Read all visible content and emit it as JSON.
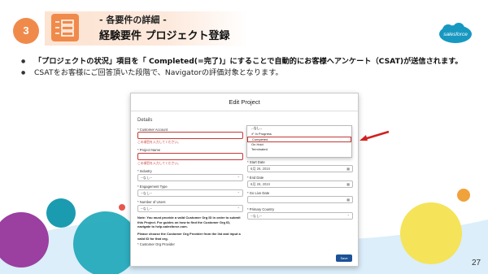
{
  "header": {
    "step_number": "3",
    "subtitle": "- 各要件の詳細 -",
    "title": "経験要件 プロジェクト登録",
    "logo_text": "salesforce"
  },
  "bullets": [
    {
      "text_pre": "「プロジェクトの状況」項目を「 Completed(=完了)」にすることで自動的にお客様へアンケート（CSAT)が送信されます。"
    },
    {
      "text": "CSATをお客様にご回答頂いた段階で、Navigatorの評価対象となります。"
    }
  ],
  "modal": {
    "title": "Edit Project",
    "section": "Details",
    "customer_account_label": "* Customer Account",
    "customer_account_error": "この項目を入力してください。",
    "project_name_label": "* Project Name",
    "project_name_error": "この項目を入力してください。",
    "industry_label": "* Industry",
    "industry_value": "--なし--",
    "engagement_type_label": "* Engagement Type",
    "engagement_type_value": "--なし--",
    "number_of_users_label": "* Number of Users",
    "number_of_users_value": "--なし--",
    "note": "Note: You must provide a valid Customer Org ID in order to submit this Project. For guides on how to find the Customer Org ID, navigate to help.salesforce.com.",
    "note2": "Please choose the Customer Org Provider from the list and input a valid ID for that org.",
    "customer_org_provider_label": "* Customer Org Provider",
    "start_date_label": "* Start Date",
    "start_date_value": "6月 26, 2024",
    "end_date_label": "* End Date",
    "end_date_value": "6月 26, 2024",
    "go_live_label": "* Go Live Date",
    "primary_country_label": "* Primary Country",
    "primary_country_value": "--なし--",
    "save_label": "Save"
  },
  "dropdown": {
    "items": [
      "--なし--",
      "✔ In Progress",
      "Completed",
      "On Hold",
      "Terminated"
    ],
    "selected_index": 2
  },
  "page_number": "27",
  "colors": {
    "accent": "#f08a4b",
    "save": "#1b5297",
    "error": "#c23934"
  }
}
